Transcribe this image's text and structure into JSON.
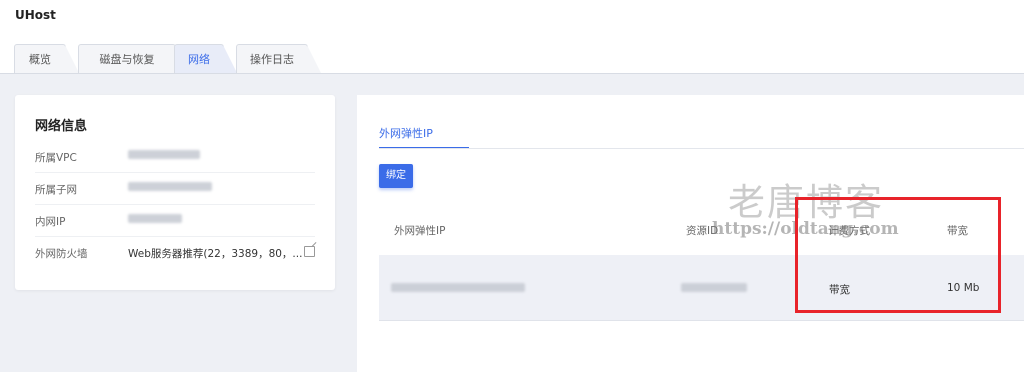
{
  "app": {
    "title": "UHost"
  },
  "tabs": [
    {
      "label": "概览"
    },
    {
      "label": "磁盘与恢复"
    },
    {
      "label": "网络"
    },
    {
      "label": "操作日志"
    }
  ],
  "network_info": {
    "title": "网络信息",
    "rows": [
      {
        "label": "所属VPC"
      },
      {
        "label": "所属子网"
      },
      {
        "label": "内网IP"
      },
      {
        "label": "外网防火墙",
        "value": "Web服务器推荐(22，3389，80，..."
      }
    ]
  },
  "eip_panel": {
    "sub_tab": "外网弹性IP",
    "bind_button": "绑定",
    "columns": {
      "eip": "外网弹性IP",
      "resource_id": "资源ID",
      "billing": "计费方式",
      "bandwidth": "带宽"
    },
    "rows": [
      {
        "billing": "带宽",
        "bandwidth": "10 Mb"
      }
    ]
  },
  "watermark": {
    "text": "老唐博客",
    "url": "https://oldtang.com"
  },
  "colors": {
    "accent": "#3b6ce8",
    "highlight": "#e8232a"
  }
}
